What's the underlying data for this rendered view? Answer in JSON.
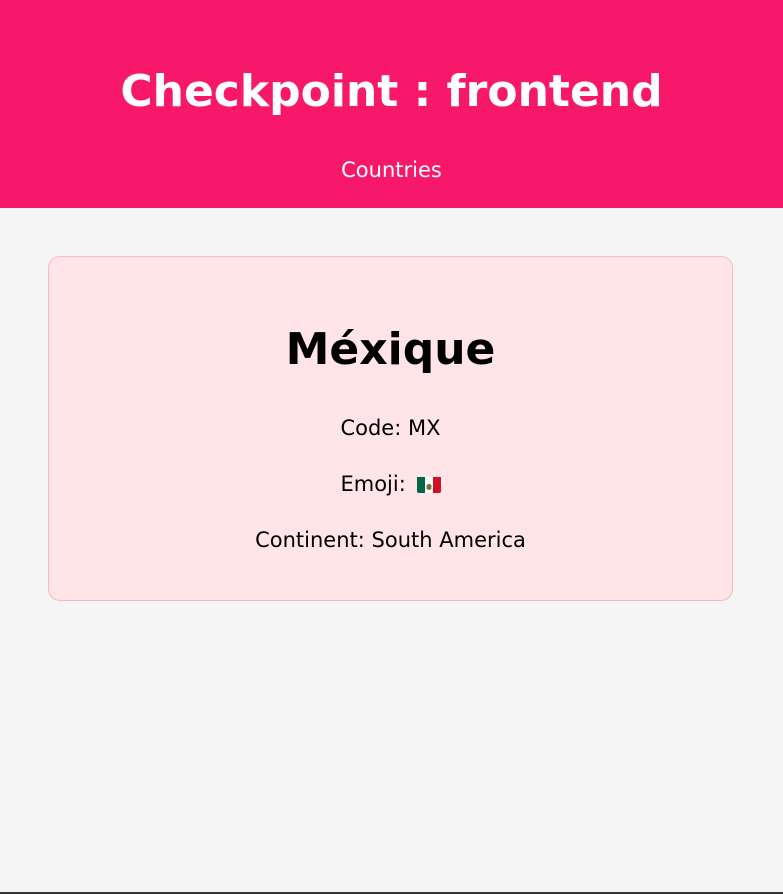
{
  "header": {
    "title": "Checkpoint : frontend",
    "nav_link": "Countries",
    "background_color": "#f8186a"
  },
  "country": {
    "name": "Méxique",
    "code_label": "Code:",
    "code": "MX",
    "emoji_label": "Emoji:",
    "emoji_icon": "mexico-flag-icon",
    "continent_label": "Continent:",
    "continent": "South America"
  }
}
